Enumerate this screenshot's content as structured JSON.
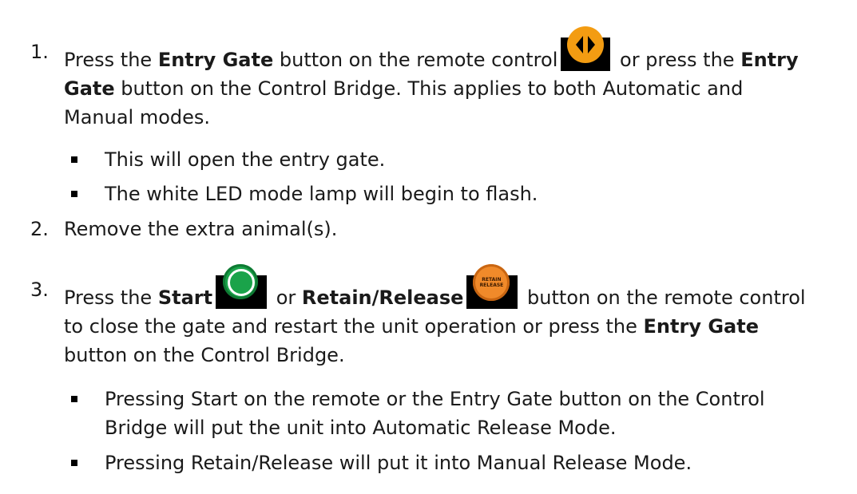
{
  "steps": [
    {
      "number": "1.",
      "p1": "Press the ",
      "b1": "Entry Gate",
      "p2": " button on the remote control",
      "p3": " or press the ",
      "b2": "Entry",
      "b2b": "Gate",
      "p4": " button on the Control Bridge. This applies to both Automatic and",
      "p5": "Manual modes.",
      "bullets": [
        "This will open the entry gate.",
        "The white LED mode lamp will begin to flash."
      ]
    },
    {
      "number": "2.",
      "text": "Remove the extra animal(s)."
    },
    {
      "number": "3.",
      "p1": "Press the ",
      "b1": "Start",
      "p2": " or ",
      "b2": "Retain/Release",
      "p3": " button on the remote control",
      "p4": "to close the gate and restart the unit operation or press the ",
      "b3": "Entry Gate",
      "p5": "button on the Control Bridge.",
      "bullets": [
        {
          "line1": "Pressing Start on the remote or the Entry Gate button on the Control",
          "line2": "Bridge will put the unit into Automatic Release Mode."
        },
        {
          "line1": "Pressing Retain/Release will put it into Manual Release Mode."
        }
      ]
    }
  ],
  "icons": {
    "entry_gate": "entry-gate-icon",
    "start": "start-icon",
    "retain_release": "retain-release-icon",
    "retain_label_1": "RETAIN",
    "retain_label_2": "RELEASE",
    "colors": {
      "entry_gate": "#f39c12",
      "start": "#1aa34a",
      "retain_release": "#f08a2a"
    }
  }
}
